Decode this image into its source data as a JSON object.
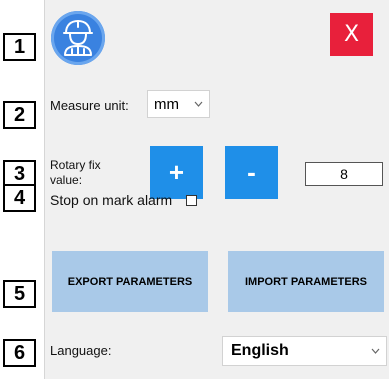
{
  "badges": [
    "1",
    "2",
    "3",
    "4",
    "5",
    "6"
  ],
  "header": {
    "avatar_icon": "engineer-helmet-icon",
    "close_label": "X"
  },
  "measure": {
    "label": "Measure unit:",
    "value": "mm"
  },
  "rotary": {
    "label_line1": "Rotary fix",
    "label_line2": "value:",
    "plus_label": "+",
    "minus_label": "-",
    "value": "8"
  },
  "alarm": {
    "label": "Stop on mark alarm",
    "checked": false
  },
  "params": {
    "export_label": "EXPORT PARAMETERS",
    "import_label": "IMPORT PARAMETERS"
  },
  "language": {
    "label": "Language:",
    "value": "English"
  },
  "colors": {
    "accent_blue": "#1f8fe8",
    "close_red": "#e8203b",
    "param_button": "#a9c9e8"
  }
}
